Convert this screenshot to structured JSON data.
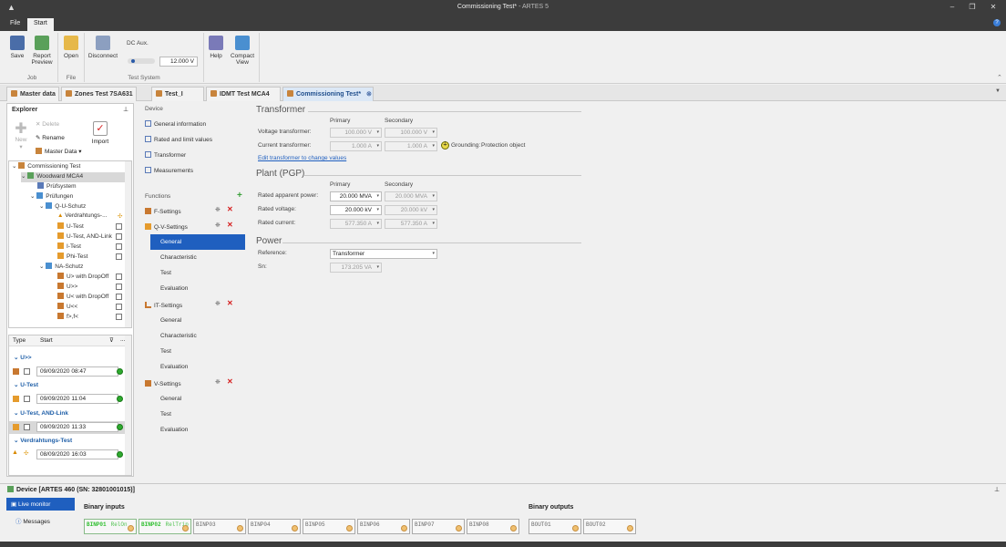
{
  "titlebar": {
    "title_main": "Commissioning Test*",
    "title_app": "- ARTES 5",
    "help_icon": "help-icon"
  },
  "menu": {
    "file": "File",
    "start": "Start"
  },
  "ribbon": {
    "save": "Save",
    "report_preview": "Report Preview",
    "open": "Open",
    "disconnect": "Disconnect",
    "dc_aux": "DC Aux.",
    "dc_value": "12.000 V",
    "help": "Help",
    "compact_view": "Compact View",
    "groups": {
      "job": "Job",
      "file": "File",
      "test_system": "Test System"
    }
  },
  "doc_tabs": [
    {
      "label": "Master data"
    },
    {
      "label": "Zones Test 7SA631"
    },
    {
      "label": "Test_I"
    },
    {
      "label": "IDMT Test MCA4"
    },
    {
      "label": "Commissioning Test*"
    }
  ],
  "explorer": {
    "title": "Explorer",
    "new": "New",
    "delete": "Delete",
    "rename": "Rename",
    "master_data": "Master Data",
    "import": "Import",
    "tree": [
      {
        "label": "Commissioning Test"
      },
      {
        "label": "Woodward MCA4"
      },
      {
        "label": "Prüfsystem"
      },
      {
        "label": "Prüfungen"
      },
      {
        "label": "Q-U-Schutz"
      },
      {
        "label": "Verdrahtungs-..."
      },
      {
        "label": "U-Test"
      },
      {
        "label": "U-Test, AND-Link"
      },
      {
        "label": "I-Test"
      },
      {
        "label": "Phi-Test"
      },
      {
        "label": "NA-Schutz"
      },
      {
        "label": "U> with DropOff"
      },
      {
        "label": "U>>"
      },
      {
        "label": "U< with DropOff"
      },
      {
        "label": "U<<"
      },
      {
        "label": "f>,f<"
      }
    ],
    "history": {
      "col_type": "Type",
      "col_start": "Start",
      "more": "...",
      "groups": [
        {
          "name": "U>>",
          "date": "09/09/2020 08:47"
        },
        {
          "name": "U-Test",
          "date": "09/09/2020 11:04"
        },
        {
          "name": "U-Test, AND-Link",
          "date": "09/09/2020 11:33"
        },
        {
          "name": "Verdrahtungs-Test",
          "date": "08/09/2020 16:03"
        }
      ]
    }
  },
  "functions": {
    "device_header": "Device",
    "device_items": [
      "General information",
      "Rated and limit values",
      "Transformer",
      "Measurements"
    ],
    "functions_header": "Functions",
    "f_settings": "F-Settings",
    "qv_settings": "Q-V-Settings",
    "qv_children": [
      "General",
      "Characteristic",
      "Test",
      "Evaluation"
    ],
    "it_settings": "IT-Settings",
    "it_children": [
      "General",
      "Characteristic",
      "Test",
      "Evaluation"
    ],
    "v_settings": "V-Settings",
    "v_children": [
      "General",
      "Test",
      "Evaluation"
    ]
  },
  "form": {
    "transformer": {
      "heading": "Transformer",
      "primary": "Primary",
      "secondary": "Secondary",
      "vt_label": "Voltage transformer:",
      "vt_primary": "100.000 V",
      "vt_secondary": "100.000 V",
      "ct_label": "Current transformer:",
      "ct_primary": "1.000 A",
      "ct_secondary": "1.000 A",
      "grounding_label": "Grounding:",
      "grounding_value": "Protection object",
      "edit_link": "Edit transformer to change values"
    },
    "plant": {
      "heading": "Plant (PGP)",
      "primary": "Primary",
      "secondary": "Secondary",
      "sap_label": "Rated apparent power:",
      "sap_primary": "20.000 MVA",
      "sap_secondary": "20.000 MVA",
      "rv_label": "Rated voltage:",
      "rv_primary": "20.000 kV",
      "rv_secondary": "20.000 kV",
      "rc_label": "Rated current:",
      "rc_primary": "577.350 A",
      "rc_secondary": "577.350 A"
    },
    "power": {
      "heading": "Power",
      "reference_label": "Reference:",
      "reference_value": "Transformer",
      "sn_label": "Sn:",
      "sn_value": "173.205 VA"
    }
  },
  "bottom": {
    "device_title": "Device [ARTES 460 (SN: 32801001015)]",
    "live_monitor": "Live monitor",
    "messages": "Messages",
    "binary_inputs": "Binary inputs",
    "binary_outputs": "Binary outputs",
    "inputs": [
      {
        "name": "BINP01",
        "sub": "RelOn"
      },
      {
        "name": "BINP02",
        "sub": "RelTrip"
      },
      {
        "name": "BINP03",
        "sub": ""
      },
      {
        "name": "BINP04",
        "sub": ""
      },
      {
        "name": "BINP05",
        "sub": ""
      },
      {
        "name": "BINP06",
        "sub": ""
      },
      {
        "name": "BINP07",
        "sub": ""
      },
      {
        "name": "BINP08",
        "sub": ""
      }
    ],
    "outputs": [
      {
        "name": "BOUT01"
      },
      {
        "name": "BOUT02"
      }
    ]
  },
  "colors": {
    "accent": "#1f5fbf",
    "dark": "#3c3c3c",
    "ok": "#2faa2f",
    "delete": "#d62020"
  }
}
